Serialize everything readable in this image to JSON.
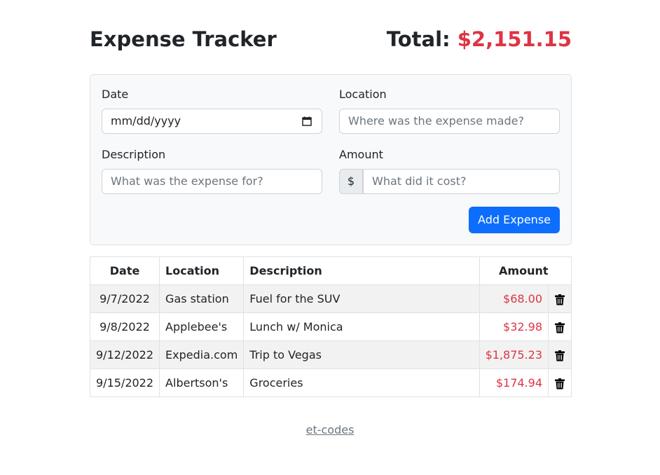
{
  "colors": {
    "primary": "#0d6efd",
    "danger": "#dc3545"
  },
  "header": {
    "title": "Expense Tracker",
    "total_label": "Total:",
    "total_value": "$2,151.15"
  },
  "form": {
    "date_label": "Date",
    "date_value": "mm/dd/yyyy",
    "location_label": "Location",
    "location_placeholder": "Where was the expense made?",
    "description_label": "Description",
    "description_placeholder": "What was the expense for?",
    "amount_label": "Amount",
    "amount_prefix": "$",
    "amount_placeholder": "What did it cost?",
    "submit_label": "Add Expense"
  },
  "table": {
    "headers": {
      "date": "Date",
      "location": "Location",
      "description": "Description",
      "amount": "Amount"
    },
    "rows": [
      {
        "date": "9/7/2022",
        "location": "Gas station",
        "description": "Fuel for the SUV",
        "amount": "$68.00"
      },
      {
        "date": "9/8/2022",
        "location": "Applebee's",
        "description": "Lunch w/ Monica",
        "amount": "$32.98"
      },
      {
        "date": "9/12/2022",
        "location": "Expedia.com",
        "description": "Trip to Vegas",
        "amount": "$1,875.23"
      },
      {
        "date": "9/15/2022",
        "location": "Albertson's",
        "description": "Groceries",
        "amount": "$174.94"
      }
    ],
    "delete_icon": "trash-icon"
  },
  "footer": {
    "link_text": "et-codes"
  }
}
